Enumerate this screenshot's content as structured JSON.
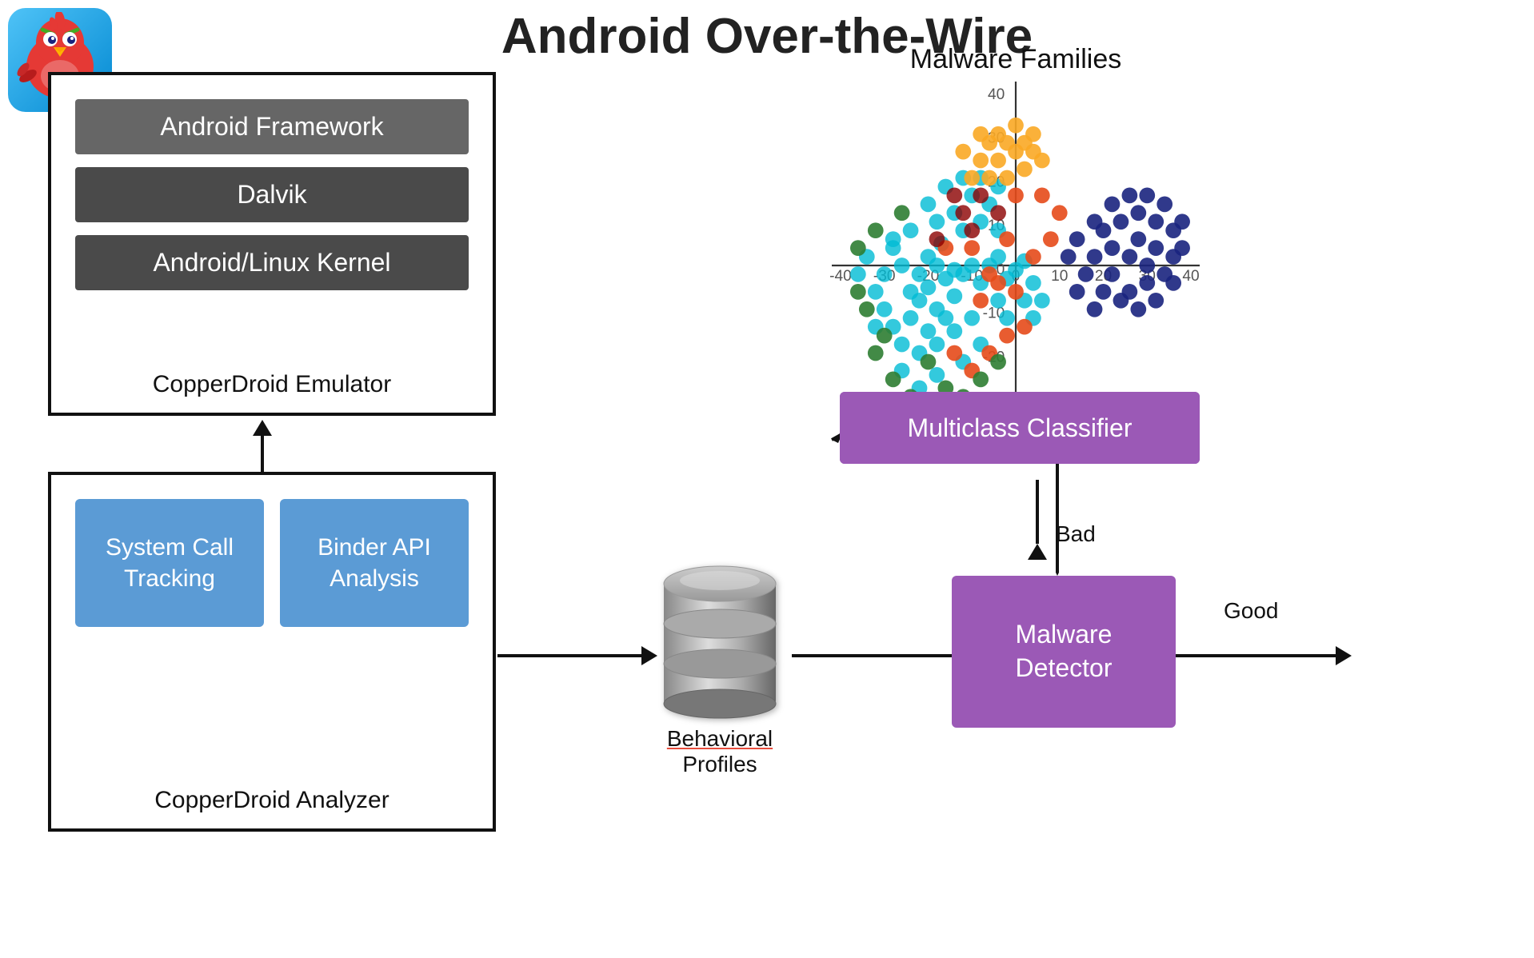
{
  "title": "Android Over-the-Wire",
  "appIcon": {
    "alt": "Angry Birds App Icon"
  },
  "emulator": {
    "label": "CopperDroid Emulator",
    "layers": [
      {
        "text": "Android Framework",
        "dark": false
      },
      {
        "text": "Dalvik",
        "dark": true
      },
      {
        "text": "Android/Linux Kernel",
        "dark": true
      }
    ]
  },
  "analyzer": {
    "label": "CopperDroid Analyzer",
    "modules": [
      {
        "text": "System Call\nTracking"
      },
      {
        "text": "Binder API\nAnalysis"
      }
    ]
  },
  "database": {
    "label": "Behavioral\nProfiles",
    "labelUnderline": "Behavioral"
  },
  "malwareDetector": {
    "text": "Malware\nDetector"
  },
  "classifier": {
    "text": "Multiclass Classifier"
  },
  "chart": {
    "title": "Malware Families"
  },
  "labels": {
    "bad": "Bad",
    "good": "Good"
  }
}
